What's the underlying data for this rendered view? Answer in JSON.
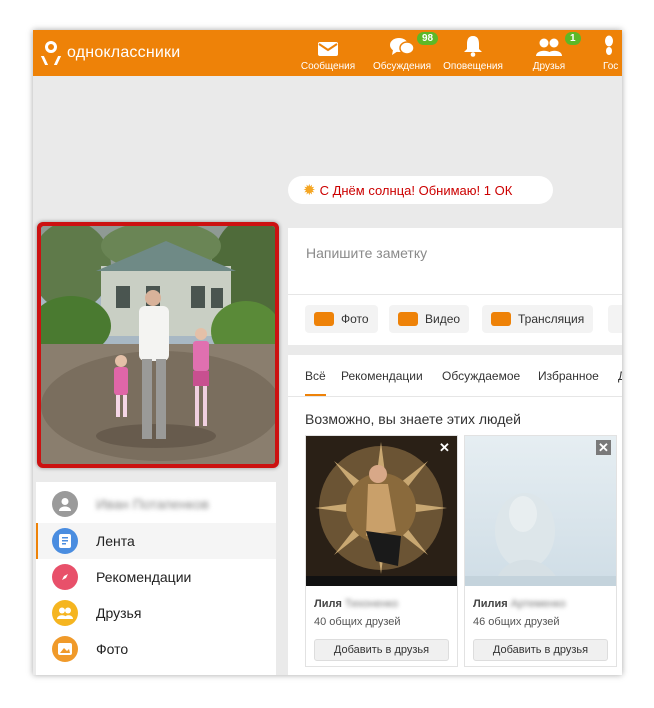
{
  "brand": {
    "name": "одноклассники",
    "color": "#ee8208"
  },
  "nav": [
    {
      "id": "messages",
      "label": "Сообщения",
      "icon": "envelope-icon",
      "badge": ""
    },
    {
      "id": "discussions",
      "label": "Обсуждения",
      "icon": "chat-bubbles-icon",
      "badge": "98"
    },
    {
      "id": "notifications",
      "label": "Оповещения",
      "icon": "bell-icon",
      "badge": ""
    },
    {
      "id": "friends",
      "label": "Друзья",
      "icon": "people-icon",
      "badge": "1"
    },
    {
      "id": "guests",
      "label": "Гос",
      "icon": "footprints-icon",
      "badge": ""
    }
  ],
  "holiday_banner": {
    "icon": "sun-icon",
    "text": "С Днём солнца! Обнимаю! 1 ОК"
  },
  "profile": {
    "name": "Иван Потапенков",
    "photo": "family-photo"
  },
  "sidebar": {
    "items": [
      {
        "label": "Лента",
        "icon": "feed-icon",
        "color": "#4a8de0",
        "active": true
      },
      {
        "label": "Рекомендации",
        "icon": "compass-icon",
        "color": "#e8506a",
        "active": false
      },
      {
        "label": "Друзья",
        "icon": "people-icon",
        "color": "#f5b520",
        "active": false
      },
      {
        "label": "Фото",
        "icon": "photo-icon",
        "color": "#f09a2a",
        "active": false
      }
    ]
  },
  "composer": {
    "placeholder": "Напишите заметку",
    "buttons": [
      {
        "label": "Фото",
        "icon": "camera-icon"
      },
      {
        "label": "Видео",
        "icon": "video-camera-icon"
      },
      {
        "label": "Трансляция",
        "icon": "broadcast-icon"
      }
    ]
  },
  "feed_tabs": [
    "Всё",
    "Рекомендации",
    "Обсуждаемое",
    "Избранное",
    "Д"
  ],
  "people": {
    "title": "Возможно, вы знаете этих людей",
    "cards": [
      {
        "first_name": "Лиля",
        "last_name": "Тихоненко",
        "mutual": "40 общих друзей",
        "add_label": "Добавить в друзья"
      },
      {
        "first_name": "Лилия",
        "last_name": "Артеменко",
        "mutual": "46 общих друзей",
        "add_label": "Добавить в друзья"
      }
    ]
  }
}
